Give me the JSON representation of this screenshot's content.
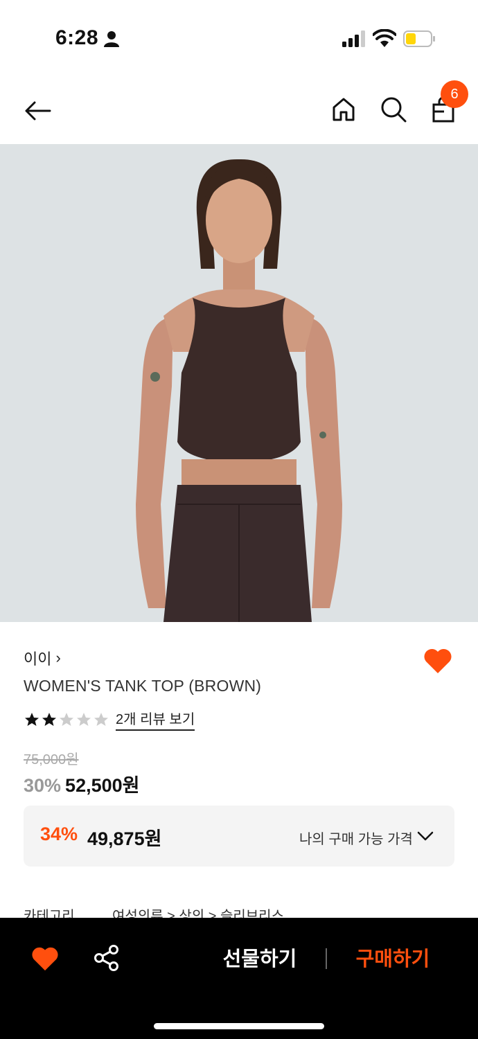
{
  "status_bar": {
    "time": "6:28",
    "person_icon": "person-icon",
    "signal_icon": "cellular-signal-icon",
    "wifi_icon": "wifi-icon",
    "battery_icon": "battery-icon",
    "battery_color": "#ffd60a"
  },
  "header": {
    "back_icon": "arrow-left-icon",
    "home_icon": "home-icon",
    "search_icon": "search-icon",
    "bag_icon": "shopping-bag-icon",
    "cart_count": "6",
    "badge_color": "#ff4f0e"
  },
  "product": {
    "brand": "이이",
    "brand_chevron": "›",
    "name": "WOMEN'S TANK TOP (BROWN)",
    "rating": 2,
    "rating_max": 5,
    "review_link": "2개 리뷰 보기",
    "original_price": "75,000원",
    "discount": "30%",
    "sale_price": "52,500원",
    "wishlisted": true
  },
  "my_price": {
    "discount": "34%",
    "price": "49,875원",
    "label": "나의 구매 가능 가격"
  },
  "category": {
    "label": "카테고리",
    "path": "여성의류 > 상의 > 슬리브리스"
  },
  "bottom_bar": {
    "heart_icon": "heart-icon",
    "share_icon": "share-icon",
    "gift_label": "선물하기",
    "buy_label": "구매하기",
    "accent_color": "#ff4f0e"
  }
}
